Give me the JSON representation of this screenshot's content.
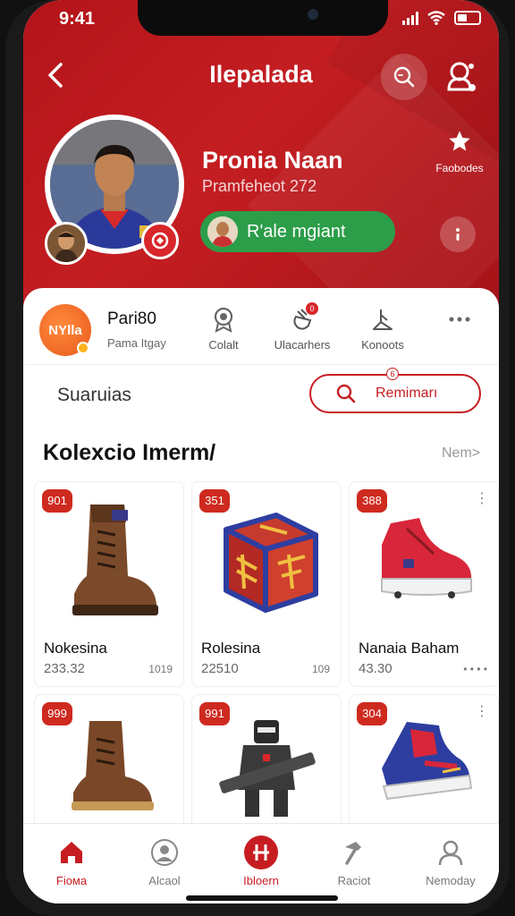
{
  "status_bar": {
    "time": "9:41"
  },
  "header": {
    "title": "Ilepalada"
  },
  "profile": {
    "name": "Pronia Naan",
    "subtitle": "Pramfeheot 272",
    "action_label": "R'ale mgiant",
    "favorites_label": "Faobodes"
  },
  "brand": {
    "logo_text": "NYlla",
    "title": "Pari80",
    "subtitle": "Pama Itgay"
  },
  "quick_actions": [
    {
      "label": "Colalt",
      "icon": "award-icon"
    },
    {
      "label": "Ulacarhers",
      "icon": "hand-pointer-icon",
      "badge": "0"
    },
    {
      "label": "Konoots",
      "icon": "lamp-icon"
    }
  ],
  "search": {
    "label": "Suaruias",
    "button_label": "Remimarı",
    "button_badge": "6"
  },
  "collection": {
    "title": "Kolexcio Imerm/",
    "more_label": "Nem>",
    "items": [
      {
        "badge": "901",
        "name": "Nokesina",
        "price": "233.32",
        "meta": "1019",
        "image": "boot-icon"
      },
      {
        "badge": "351",
        "name": "Rolesina",
        "price": "22510",
        "meta": "109",
        "image": "gift-cube-icon"
      },
      {
        "badge": "388",
        "name": "Nanaia Baham",
        "price": "43.30",
        "meta": "",
        "image": "sneaker-icon"
      },
      {
        "badge": "999",
        "name": "",
        "price": "",
        "meta": "",
        "image": "boot-icon"
      },
      {
        "badge": "991",
        "name": "",
        "price": "",
        "meta": "",
        "image": "robot-figure-icon"
      },
      {
        "badge": "304",
        "name": "",
        "price": "",
        "meta": "",
        "image": "sneaker-icon"
      }
    ]
  },
  "bottom_nav": [
    {
      "label": "Fiома",
      "icon": "home-icon",
      "active": true
    },
    {
      "label": "Alcaol",
      "icon": "person-icon",
      "active": false
    },
    {
      "label": "Ibloern",
      "icon": "circle-plus-icon",
      "active": false
    },
    {
      "label": "Raciot",
      "icon": "hammer-icon",
      "active": false
    },
    {
      "label": "Nemoday",
      "icon": "user-icon",
      "active": false
    }
  ],
  "colors": {
    "brand_red": "#c41e22",
    "action_green": "#2c9d49",
    "badge_red": "#cf2a1f"
  }
}
